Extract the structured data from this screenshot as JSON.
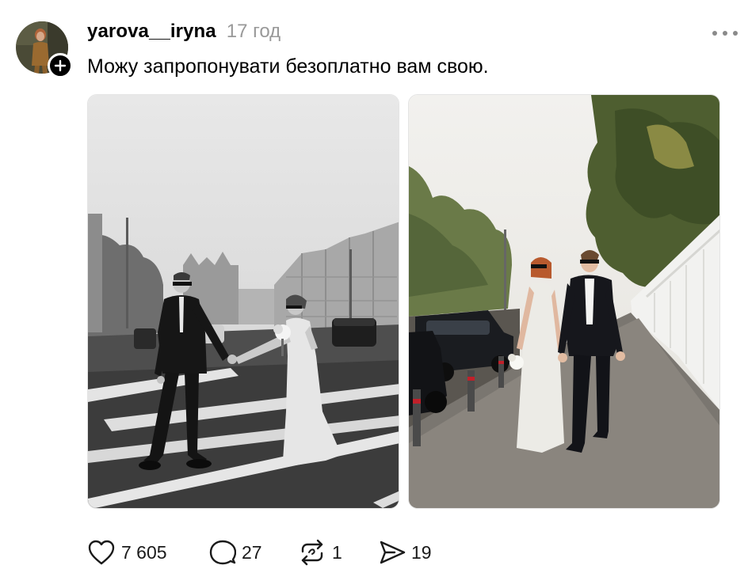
{
  "post": {
    "author": {
      "username": "yarova__iryna",
      "avatar_icon": "profile-photo",
      "follow_icon": "plus-icon"
    },
    "timestamp": "17 год",
    "menu_icon": "more-horizontal-icon",
    "text": "Можу запропонувати безоплатно вам свою.",
    "media": [
      {
        "kind": "photo",
        "style": "black-and-white",
        "icon": "wedding-couple-street-photo"
      },
      {
        "kind": "photo",
        "style": "color",
        "icon": "wedding-couple-sidewalk-photo"
      }
    ],
    "actions": {
      "likes": {
        "icon": "heart-icon",
        "count": "7 605"
      },
      "replies": {
        "icon": "comment-icon",
        "count": "27"
      },
      "reposts": {
        "icon": "repost-icon",
        "count": "1"
      },
      "shares": {
        "icon": "send-icon",
        "count": "19"
      }
    }
  },
  "colors": {
    "text_primary": "#000000",
    "text_secondary": "#999999",
    "background": "#ffffff"
  }
}
